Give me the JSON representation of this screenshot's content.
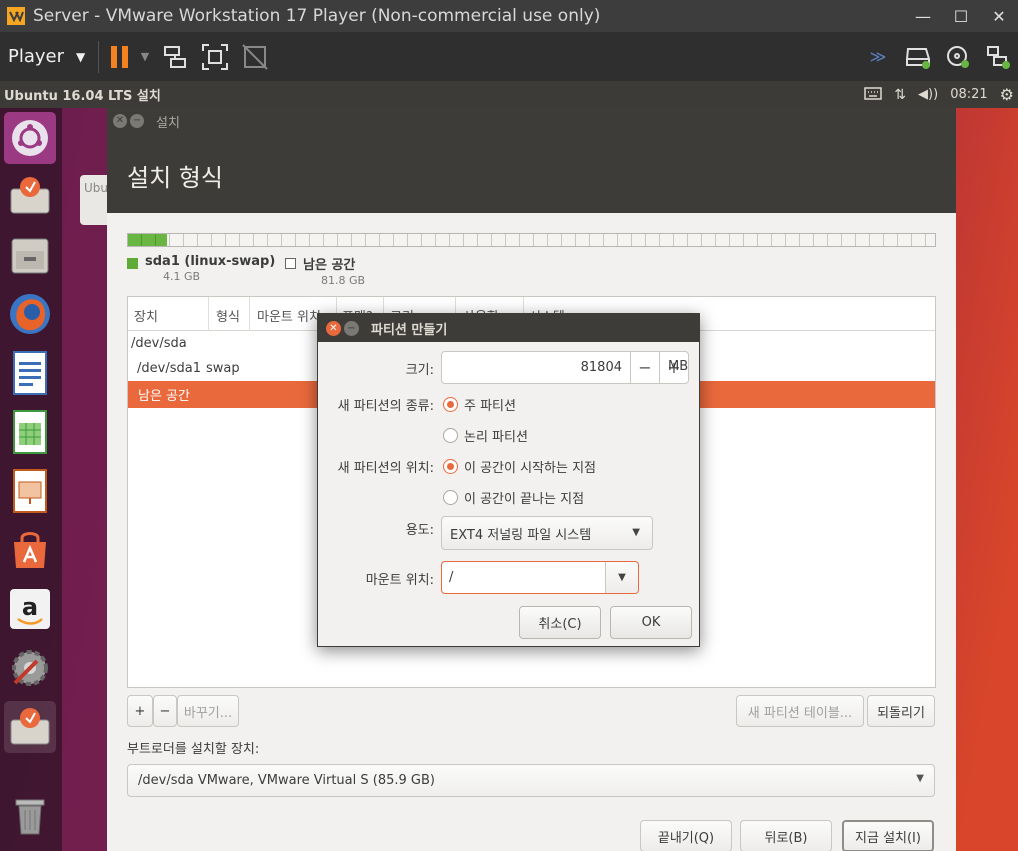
{
  "vmware": {
    "title": "Server - VMware Workstation 17 Player (Non-commercial use only)",
    "player_menu": "Player"
  },
  "ubuntu_panel": {
    "title": "Ubuntu 16.04 LTS 설치",
    "time": "08:21"
  },
  "background_window": {
    "label": "Ubu"
  },
  "installer": {
    "window_title": "설치",
    "heading": "설치 형식",
    "partition_bar": {
      "swap_fraction": 0.048
    },
    "legend": [
      {
        "name": "sda1 (linux-swap)",
        "size": "4.1 GB",
        "color": "#5eac37",
        "filled": true
      },
      {
        "name": "남은 공간",
        "size": "81.8 GB",
        "color": "#ffffff",
        "filled": false
      }
    ],
    "table": {
      "headers": [
        "장치",
        "형식",
        "마운트 위치",
        "포맷?",
        "크기",
        "사용함",
        "시스템"
      ],
      "rows": [
        {
          "device": "/dev/sda",
          "type": ""
        },
        {
          "device": "/dev/sda1",
          "type": "swap"
        },
        {
          "device": "남은 공간",
          "type": ""
        }
      ]
    },
    "buttons": {
      "add": "+",
      "remove": "−",
      "change": "바꾸기...",
      "new_table": "새 파티션 테이블...",
      "revert": "되돌리기",
      "quit": "끝내기(Q)",
      "back": "뒤로(B)",
      "install_now": "지금 설치(I)"
    },
    "bootloader_label": "부트로더를 설치할 장치:",
    "bootloader_device": "/dev/sda VMware, VMware Virtual S (85.9 GB)"
  },
  "dialog": {
    "title": "파티션 만들기",
    "size_label": "크기:",
    "size_value": "81804",
    "size_unit": "MB",
    "type_label": "새 파티션의 종류:",
    "type_primary": "주 파티션",
    "type_logical": "논리 파티션",
    "location_label": "새 파티션의 위치:",
    "location_start": "이 공간이 시작하는 지점",
    "location_end": "이 공간이 끝나는 지점",
    "use_label": "용도:",
    "use_value": "EXT4 저널링 파일 시스템",
    "mount_label": "마운트 위치:",
    "mount_value": "/",
    "cancel": "취소(C)",
    "ok": "OK"
  },
  "colors": {
    "accent": "#e9693c",
    "swap": "#5eac37",
    "vmware_pause": "#f58220"
  },
  "icons": [
    "vmware-logo-icon",
    "pause-icon",
    "send-keys-icon",
    "fullscreen-icon",
    "unity-icon",
    "network-icon",
    "disk-icon",
    "cd-icon",
    "usb-icon",
    "keyboard-icon",
    "transfer-icon",
    "volume-icon",
    "settings-icon"
  ]
}
